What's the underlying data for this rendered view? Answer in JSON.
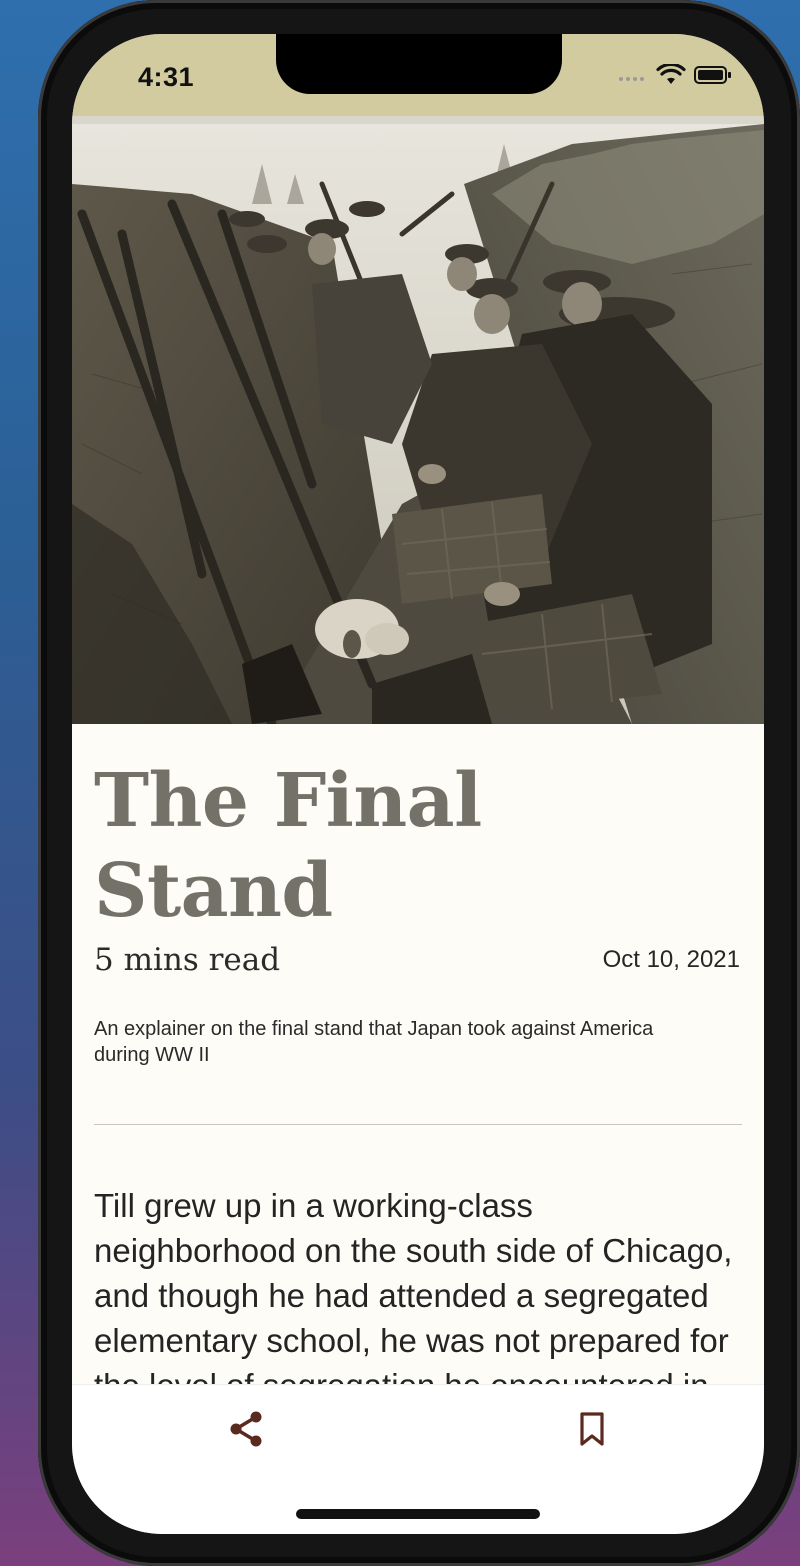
{
  "status_bar": {
    "time": "4:31",
    "icons": [
      "cellular-icon",
      "wifi-icon",
      "battery-icon"
    ]
  },
  "article": {
    "hero_image": "trench-soldiers-photo",
    "title": "The Final Stand",
    "read_time": "5 mins read",
    "date": "Oct 10, 2021",
    "summary": "An explainer on the final stand that Japan took against America during WW II",
    "body": "Till grew up in a working-class neighborhood on the south side of Chicago, and though he had attended a segregated elementary school, he was not prepared for the level of segregation he encountered in Mississippi. His mother warned him"
  },
  "tab_bar": {
    "items": [
      "share-icon",
      "bookmark-icon"
    ]
  },
  "colors": {
    "status_bar_bg": "#d2cba0",
    "page_bg": "#fdfcf6",
    "title_color": "#747169",
    "icon_color": "#5b2a1f"
  }
}
